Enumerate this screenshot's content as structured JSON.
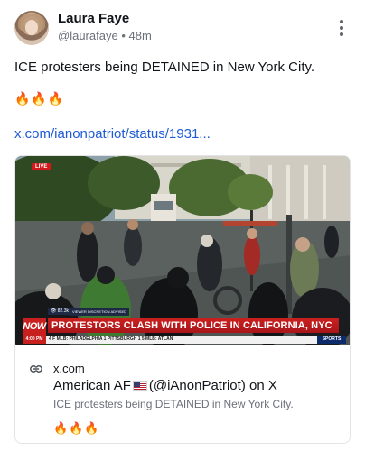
{
  "post": {
    "author_name": "Laura Faye",
    "handle": "@laurafaye",
    "separator": "•",
    "time_ago": "48m",
    "body_text": "ICE protesters being DETAINED in New York City.",
    "body_emojis": "🔥🔥🔥",
    "link_text": "x.com/ianonpatriot/status/1931..."
  },
  "card": {
    "live_badge": "LIVE",
    "viewers": "82.3k",
    "advisory": "VIEWER DISCRETION ADVISED",
    "network_logo": "NOW",
    "network_logo_top": "LIVE",
    "headline": "PROTESTORS CLASH WITH POLICE IN CALIFORNIA, NYC",
    "broadcast_time": "4:00 PM CT",
    "ticker": "4  F  MLB:  PHILADELPHIA  1  PITTSBURGH  1  5    MLB:  ATLAN",
    "sports_label": "SPORTS",
    "domain": "x.com",
    "title_before_flag": "American AF",
    "title_after_flag": "(@iAnonPatriot) on X",
    "description": "ICE protesters being DETAINED in New York City.",
    "emojis": "🔥🔥🔥"
  },
  "colors": {
    "link": "#1f5bd6",
    "headline_red": "#c9201e",
    "muted_text": "#6b7079"
  },
  "icons": {
    "more": "vertical-ellipsis",
    "link": "chain-link"
  }
}
